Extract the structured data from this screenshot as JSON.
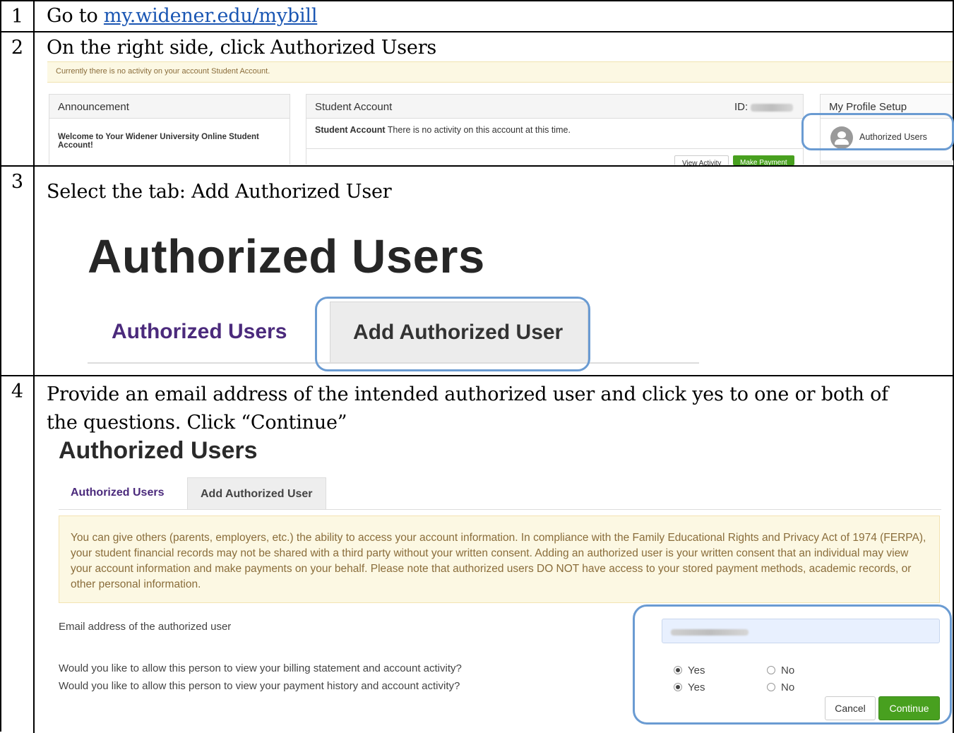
{
  "steps": [
    {
      "num": "1",
      "text_prefix": "Go to ",
      "link": "my.widener.edu/mybill"
    },
    {
      "num": "2",
      "text": "On the right side, click Authorized Users"
    },
    {
      "num": "3",
      "text": "Select the tab: Add Authorized User"
    },
    {
      "num": "4",
      "text_line1": "Provide an email address of the intended authorized user and click yes to one or both of",
      "text_line2": "the questions.  Click “Continue”"
    }
  ],
  "portal": {
    "notice": "Currently there is no activity on your account Student Account.",
    "announcement": {
      "title": "Announcement",
      "body": "Welcome to Your Widener University Online Student Account!"
    },
    "student_account": {
      "title": "Student Account",
      "id_label": "ID:",
      "body_bold": "Student Account",
      "body_rest": " There is no activity on this account at this time.",
      "view_activity": "View Activity",
      "make_payment": "Make Payment"
    },
    "profile": {
      "title": "My Profile Setup",
      "authorized_users": "Authorized Users"
    }
  },
  "zoom_tabs": {
    "title": "Authorized Users",
    "tab_authorized": "Authorized Users",
    "tab_add": "Add Authorized User"
  },
  "form": {
    "title": "Authorized Users",
    "tab_authorized": "Authorized Users",
    "tab_add": "Add Authorized User",
    "info": "You can give others (parents, employers, etc.) the ability to access your account information. In compliance with the Family Educational Rights and Privacy Act of 1974 (FERPA), your student financial records may not be shared with a third party without your written consent. Adding an authorized user is your written consent that an individual may view your account information and make payments on your behalf. Please note that authorized users DO NOT have access to your stored payment methods, academic records, or other personal information.",
    "email_label": "Email address of the authorized user",
    "q1": "Would you like to allow this person to view your billing statement and account activity?",
    "q2": "Would you like to allow this person to view your payment history and account activity?",
    "yes": "Yes",
    "no": "No",
    "cancel": "Cancel",
    "continue": "Continue"
  },
  "colors": {
    "highlight": "#6a9bd2",
    "purple": "#4b2a7c",
    "green": "#48a01f",
    "link": "#1a56b3"
  }
}
